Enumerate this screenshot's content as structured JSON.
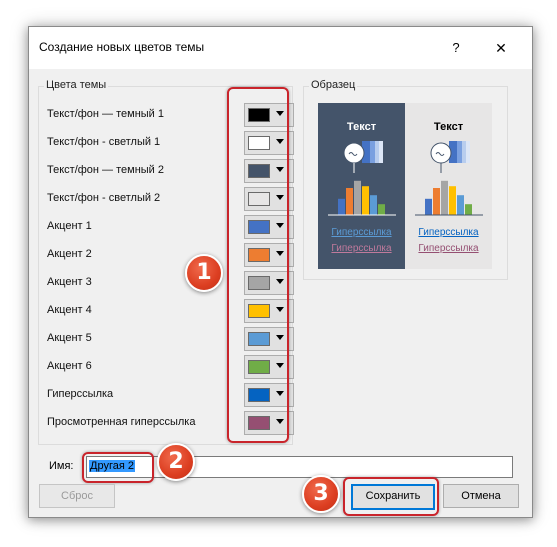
{
  "dialog": {
    "title": "Создание новых цветов темы",
    "help_label": "?",
    "close_label": "✕"
  },
  "theme_colors": {
    "group_label": "Цвета темы",
    "items": [
      {
        "label": "Текст/фон — темный 1",
        "color": "#000000"
      },
      {
        "label": "Текст/фон - светлый 1",
        "color": "#ffffff"
      },
      {
        "label": "Текст/фон — темный 2",
        "color": "#44546a"
      },
      {
        "label": "Текст/фон - светлый 2",
        "color": "#e7e6e6"
      },
      {
        "label": "Акцент 1",
        "color": "#4472c4"
      },
      {
        "label": "Акцент 2",
        "color": "#ed7d31"
      },
      {
        "label": "Акцент 3",
        "color": "#a5a5a5"
      },
      {
        "label": "Акцент 4",
        "color": "#ffc000"
      },
      {
        "label": "Акцент 5",
        "color": "#5b9bd5"
      },
      {
        "label": "Акцент 6",
        "color": "#70ad47"
      },
      {
        "label": "Гиперссылка",
        "color": "#0563c1"
      },
      {
        "label": "Просмотренная гиперссылка",
        "color": "#954f72"
      }
    ]
  },
  "sample": {
    "group_label": "Образец",
    "dark": {
      "text": "Текст",
      "link": "Гиперссылка",
      "visited": "Гиперссылка",
      "background": "#44546a"
    },
    "light": {
      "text": "Текст",
      "link": "Гиперссылка",
      "visited": "Гиперссылка",
      "background": "#e7e6e6"
    },
    "bar_colors": [
      "#4472c4",
      "#ed7d31",
      "#a5a5a5",
      "#ffc000",
      "#5b9bd5",
      "#70ad47"
    ],
    "bar_levels": [
      0.45,
      0.75,
      0.95,
      0.8,
      0.55,
      0.3
    ]
  },
  "name_field": {
    "label": "Имя:",
    "value": "Другая 2"
  },
  "buttons": {
    "reset": "Сброс",
    "save": "Сохранить",
    "cancel": "Отмена"
  },
  "badges": {
    "one": "1",
    "two": "2",
    "three": "3"
  },
  "accent": {
    "annotation_red": "#c9242b",
    "focus_blue": "#0078d7"
  }
}
